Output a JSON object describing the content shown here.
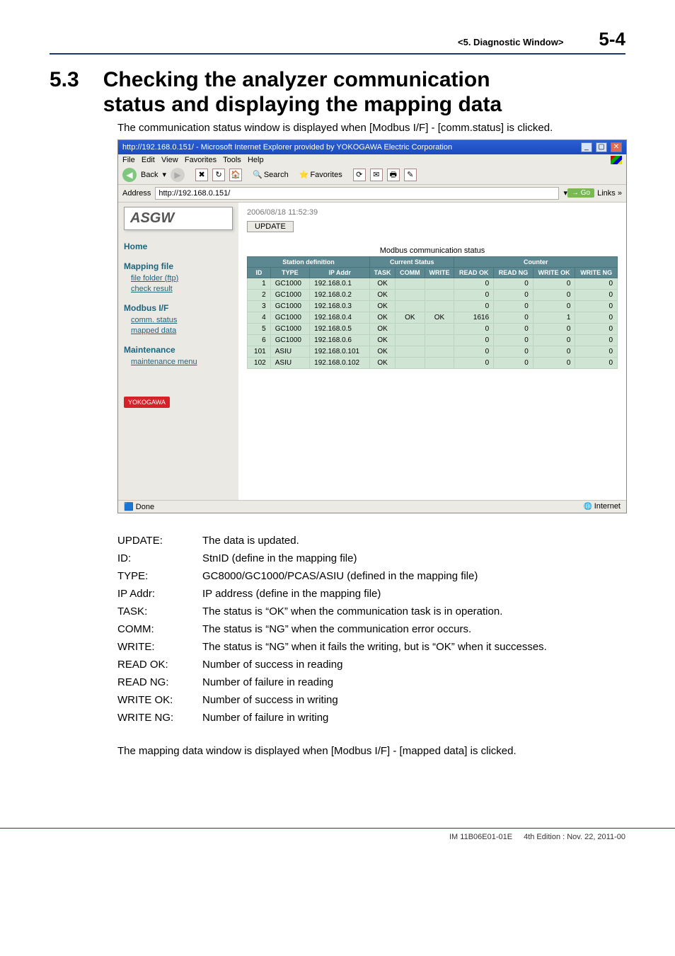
{
  "header": {
    "chapter_ref": "<5.  Diagnostic Window>",
    "page_no": "5-4"
  },
  "section": {
    "number": "5.3",
    "title_line1": "Checking the analyzer communication",
    "title_line2": "status and displaying the mapping data",
    "intro": "The communication status window is displayed when [Modbus I/F] - [comm.status] is clicked."
  },
  "screenshot": {
    "titlebar": "http://192.168.0.151/ - Microsoft Internet Explorer provided by YOKOGAWA Electric Corporation",
    "menus": [
      "File",
      "Edit",
      "View",
      "Favorites",
      "Tools",
      "Help"
    ],
    "toolbar": {
      "back": "Back",
      "search": "Search",
      "favorites": "Favorites"
    },
    "addrbar": {
      "label": "Address",
      "value": "http://192.168.0.151/",
      "go": "Go",
      "links": "Links"
    },
    "logo": "ASGW",
    "timestamp": "2006/08/18 11:52:39",
    "update_btn": "UPDATE",
    "status_label": "Modbus communication status",
    "sidebar": {
      "home": "Home",
      "mapping_file": "Mapping file",
      "file_folder": "file folder (ftp)",
      "check_result": "check result",
      "modbus_if": "Modbus I/F",
      "comm_status": "comm. status",
      "mapped_data": "mapped data",
      "maintenance": "Maintenance",
      "maintenance_menu": "maintenance menu",
      "yokogawa": "YOKOGAWA"
    },
    "table": {
      "group1": "Station definition",
      "group2": "Current Status",
      "group3": "Counter",
      "cols": [
        "ID",
        "TYPE",
        "IP Addr",
        "TASK",
        "COMM",
        "WRITE",
        "READ OK",
        "READ NG",
        "WRITE OK",
        "WRITE NG"
      ],
      "rows": [
        {
          "id": "1",
          "type": "GC1000",
          "ip": "192.168.0.1",
          "task": "OK",
          "comm": "",
          "write": "",
          "rok": "0",
          "rng": "0",
          "wok": "0",
          "wng": "0"
        },
        {
          "id": "2",
          "type": "GC1000",
          "ip": "192.168.0.2",
          "task": "OK",
          "comm": "",
          "write": "",
          "rok": "0",
          "rng": "0",
          "wok": "0",
          "wng": "0"
        },
        {
          "id": "3",
          "type": "GC1000",
          "ip": "192.168.0.3",
          "task": "OK",
          "comm": "",
          "write": "",
          "rok": "0",
          "rng": "0",
          "wok": "0",
          "wng": "0"
        },
        {
          "id": "4",
          "type": "GC1000",
          "ip": "192.168.0.4",
          "task": "OK",
          "comm": "OK",
          "write": "OK",
          "rok": "1616",
          "rng": "0",
          "wok": "1",
          "wng": "0"
        },
        {
          "id": "5",
          "type": "GC1000",
          "ip": "192.168.0.5",
          "task": "OK",
          "comm": "",
          "write": "",
          "rok": "0",
          "rng": "0",
          "wok": "0",
          "wng": "0"
        },
        {
          "id": "6",
          "type": "GC1000",
          "ip": "192.168.0.6",
          "task": "OK",
          "comm": "",
          "write": "",
          "rok": "0",
          "rng": "0",
          "wok": "0",
          "wng": "0"
        },
        {
          "id": "101",
          "type": "ASIU",
          "ip": "192.168.0.101",
          "task": "OK",
          "comm": "",
          "write": "",
          "rok": "0",
          "rng": "0",
          "wok": "0",
          "wng": "0"
        },
        {
          "id": "102",
          "type": "ASIU",
          "ip": "192.168.0.102",
          "task": "OK",
          "comm": "",
          "write": "",
          "rok": "0",
          "rng": "0",
          "wok": "0",
          "wng": "0"
        }
      ]
    },
    "statusbar": {
      "done": "Done",
      "zone": "Internet"
    }
  },
  "defs": [
    {
      "k": "UPDATE:",
      "v": "The data is updated."
    },
    {
      "k": "ID:",
      "v": "StnID (define in the mapping file)"
    },
    {
      "k": "TYPE:",
      "v": "GC8000/GC1000/PCAS/ASIU (defined in the mapping file)"
    },
    {
      "k": "IP Addr:",
      "v": "IP address (define in the mapping file)"
    },
    {
      "k": "TASK:",
      "v": "The status is “OK” when the communication task is in operation."
    },
    {
      "k": "COMM:",
      "v": "The status is “NG” when the communication error occurs."
    },
    {
      "k": "WRITE:",
      "v": "The status is “NG” when it fails the writing, but is “OK” when it successes."
    },
    {
      "k": "READ OK:",
      "v": "Number of success in reading"
    },
    {
      "k": "READ NG:",
      "v": "Number of failure in reading"
    },
    {
      "k": "WRITE OK:",
      "v": "Number of success in writing"
    },
    {
      "k": "WRITE NG:",
      "v": "Number of failure in writing"
    }
  ],
  "trail": "The mapping data window is displayed when [Modbus I/F] - [mapped data] is clicked.",
  "footer": {
    "pub": "IM 11B06E01-01E",
    "ed": "4th Edition : Nov. 22, 2011-00"
  }
}
